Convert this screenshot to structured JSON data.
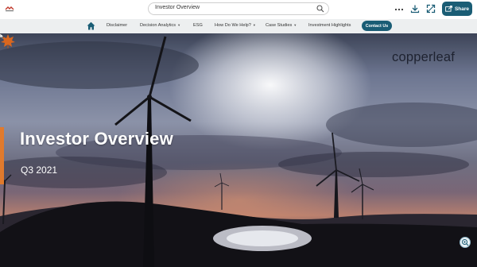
{
  "topbar": {
    "search_value": "Investor Overview",
    "share_label": "Share",
    "icons": [
      "search-icon",
      "more-icon",
      "download-icon",
      "fullscreen-icon",
      "share-icon"
    ]
  },
  "nav": {
    "items": [
      {
        "label": "Disclaimer",
        "dropdown": false
      },
      {
        "label": "Decision Analytics",
        "dropdown": true
      },
      {
        "label": "ESG",
        "dropdown": false
      },
      {
        "label": "How Do We Help?",
        "dropdown": true
      },
      {
        "label": "Case Studies",
        "dropdown": true
      },
      {
        "label": "Investment Highlights",
        "dropdown": false
      }
    ],
    "contact_label": "Contact Us"
  },
  "hero": {
    "title": "Investor Overview",
    "subtitle": "Q3 2021",
    "logo_text": "copperleaf"
  },
  "colors": {
    "brand": "#1a5d75",
    "accent": "#e07a2d",
    "nav_bg": "#edeff0"
  }
}
